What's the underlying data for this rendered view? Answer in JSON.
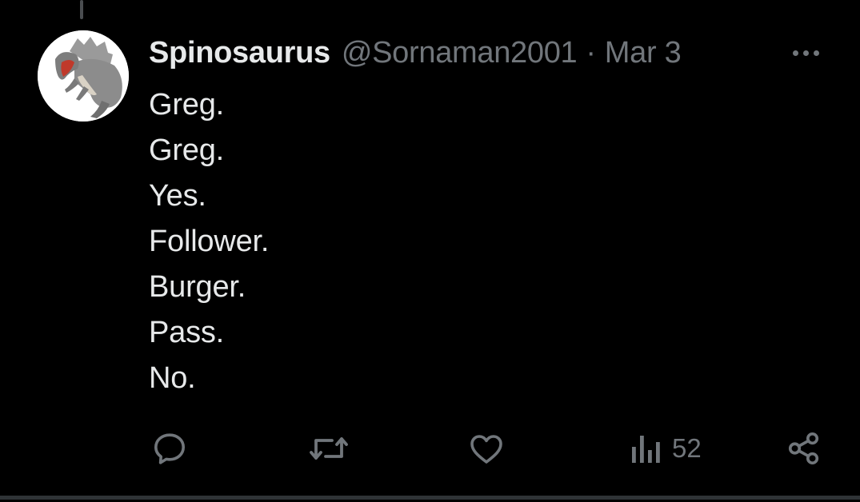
{
  "tweet": {
    "author": {
      "display_name": "Spinosaurus",
      "handle": "@Sornaman2001",
      "avatar": "spinosaurus-figure"
    },
    "separator": "·",
    "date": "Mar 3",
    "lines": [
      "Greg.",
      "Greg.",
      "Yes.",
      "Follower.",
      "Burger.",
      "Pass.",
      "No."
    ],
    "actions": {
      "reply_icon": "reply-icon",
      "retweet_icon": "retweet-icon",
      "like_icon": "heart-icon",
      "views_icon": "views-icon",
      "views_count": "52",
      "share_icon": "share-icon",
      "more_icon": "more-icon"
    }
  },
  "colors": {
    "background": "#000000",
    "primary_text": "#e7e9ea",
    "secondary_text": "#71767b",
    "divider": "#2f3336"
  }
}
